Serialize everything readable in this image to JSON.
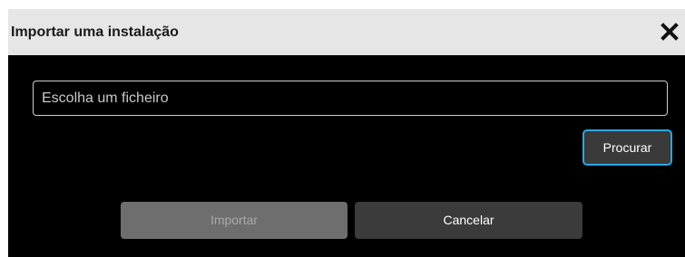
{
  "dialog": {
    "title": "Importar uma instalação",
    "close_icon": "close-icon",
    "file_input": {
      "value": "",
      "placeholder": "Escolha um ficheiro"
    },
    "browse_label": "Procurar",
    "import_label": "Importar",
    "cancel_label": "Cancelar"
  },
  "colors": {
    "title_bar_bg": "#e6e6e6",
    "dialog_bg": "#000000",
    "focus_outline": "#2aa7e0",
    "disabled_button_bg": "#6e6e6e",
    "button_bg": "#3b3b3b"
  }
}
